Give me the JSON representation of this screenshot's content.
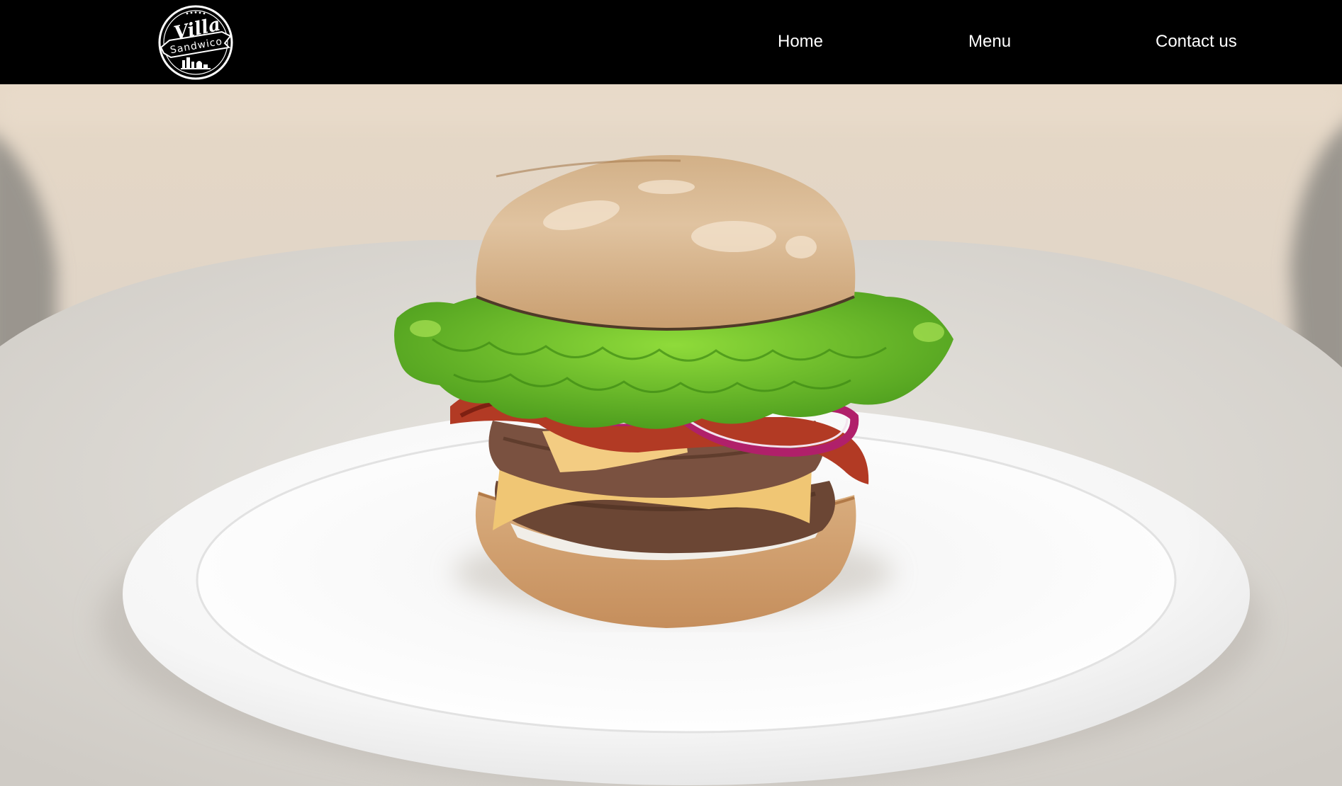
{
  "brand": {
    "logo_line1": "Villa",
    "logo_line2": "Sandwico"
  },
  "nav": {
    "home": "Home",
    "menu": "Menu",
    "contact": "Contact us"
  },
  "colors": {
    "navbar_bg": "#000000",
    "nav_text": "#ffffff"
  },
  "hero": {
    "subject": "burger-on-plate-photo"
  }
}
